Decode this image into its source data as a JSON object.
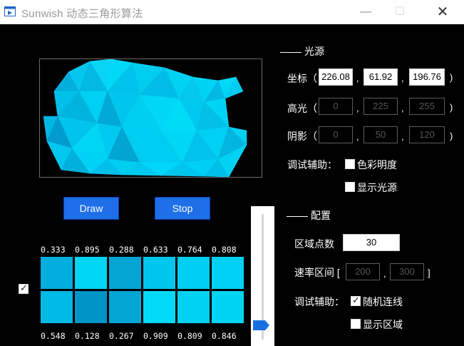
{
  "window": {
    "title": "Sunwish 动态三角形算法",
    "min_glyph": "—",
    "max_glyph": "☐",
    "close_glyph": "✕"
  },
  "controls": {
    "draw_label": "Draw",
    "stop_label": "Stop",
    "side_checkbox_checked": true,
    "slider_level": 0.05
  },
  "values_top": [
    "0.333",
    "0.895",
    "0.288",
    "0.633",
    "0.764",
    "0.808"
  ],
  "values_bottom": [
    "0.548",
    "0.128",
    "0.267",
    "0.909",
    "0.809",
    "0.846"
  ],
  "swatches_top": [
    "#02aedd",
    "#00d5f6",
    "#03a5d3",
    "#00c6ed",
    "#00cef2",
    "#00d0f3"
  ],
  "swatches_bottom": [
    "#01b9e5",
    "#0194c6",
    "#02a6d5",
    "#00daf8",
    "#00d2f4",
    "#00d4f5"
  ],
  "light": {
    "section_label": "光源",
    "coord_label": "坐标（",
    "coord": [
      "226.08",
      "61.92",
      "196.76"
    ],
    "highlight_label": "高光（",
    "highlight": [
      "0",
      "225",
      "255"
    ],
    "shadow_label": "阴影（",
    "shadow": [
      "0",
      "50",
      "120"
    ],
    "close_paren": ")",
    "comma": ",",
    "debug_label": "调试辅助：",
    "opt_color_brightness": "色彩明度",
    "opt_color_brightness_checked": false,
    "opt_show_light": "显示光源",
    "opt_show_light_checked": false
  },
  "config": {
    "section_label": "配置",
    "points_label": "区域点数",
    "points_value": "30",
    "rate_label": "速率区间 [",
    "rate": [
      "200",
      "300"
    ],
    "rate_close": "]",
    "comma": ",",
    "debug_label": "调试辅助：",
    "opt_random_lines": "随机连线",
    "opt_random_lines_checked": true,
    "opt_show_region": "显示区域",
    "opt_show_region_checked": false
  }
}
